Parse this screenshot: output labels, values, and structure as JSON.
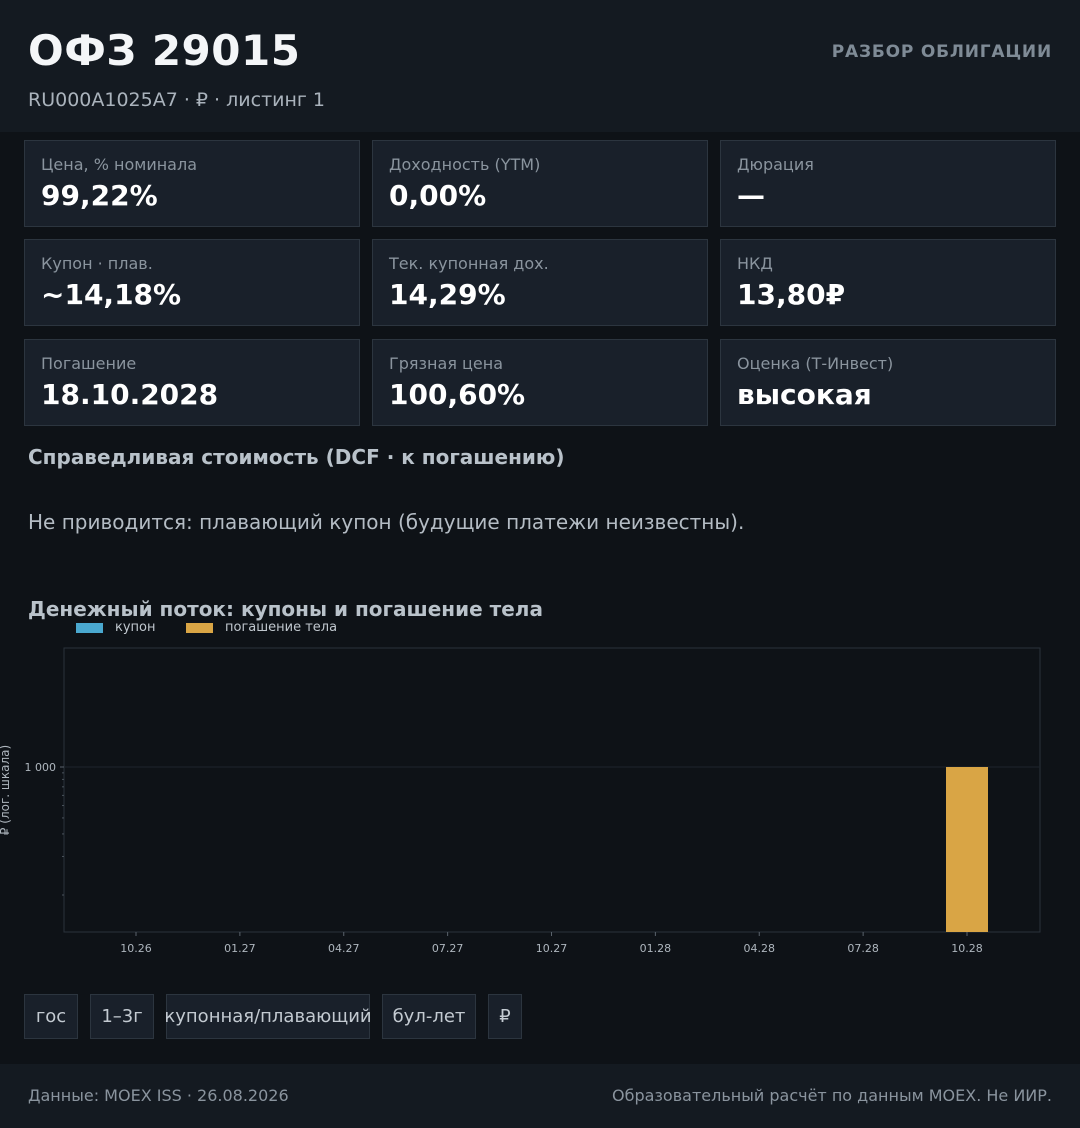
{
  "header": {
    "title": "ОФЗ 29015",
    "subtitle": "RU000A1025A7  ·  ₽  ·  листинг 1",
    "tag": "РАЗБОР ОБЛИГАЦИИ"
  },
  "metrics": [
    {
      "label": "Цена, % номинала",
      "value": "99,22%"
    },
    {
      "label": "Доходность (YTM)",
      "value": "0,00%"
    },
    {
      "label": "Дюрация",
      "value": "—"
    },
    {
      "label": "Купон · плав.",
      "value": "~14,18%"
    },
    {
      "label": "Тек. купонная дох.",
      "value": "14,29%"
    },
    {
      "label": "НКД",
      "value": "13,80₽"
    },
    {
      "label": "Погашение",
      "value": "18.10.2028"
    },
    {
      "label": "Грязная цена",
      "value": "100,60%"
    },
    {
      "label": "Оценка (Т-Инвест)",
      "value": "высокая"
    }
  ],
  "fair_value": {
    "title": "Справедливая стоимость (DCF · к погашению)",
    "note": "Не приводится: плавающий купон (будущие платежи неизвестны)."
  },
  "cashflow": {
    "title": "Денежный поток: купоны и погашение тела"
  },
  "chart_data": {
    "type": "bar",
    "title": "",
    "ylabel": "₽ (лог. шкала)",
    "yscale": "log",
    "yticks": [
      "1 000"
    ],
    "x_ticks": [
      "10.26",
      "01.27",
      "04.27",
      "07.27",
      "10.27",
      "01.28",
      "04.28",
      "07.28",
      "10.28"
    ],
    "series": [
      {
        "name": "купон",
        "color": "#4aa8cf",
        "points": []
      },
      {
        "name": "погашение тела",
        "color": "#d9a545",
        "points": [
          {
            "x": "10.28",
            "y": 1000
          }
        ]
      }
    ],
    "legend": "top-left",
    "grid": true
  },
  "tags": [
    "гос",
    "1–3г",
    "купонная/плавающий",
    "бул-лет",
    "₽"
  ],
  "footer": {
    "left": "Данные: MOEX ISS · 26.08.2026",
    "right": "Образовательный расчёт по данным MOEX. Не ИИР."
  }
}
